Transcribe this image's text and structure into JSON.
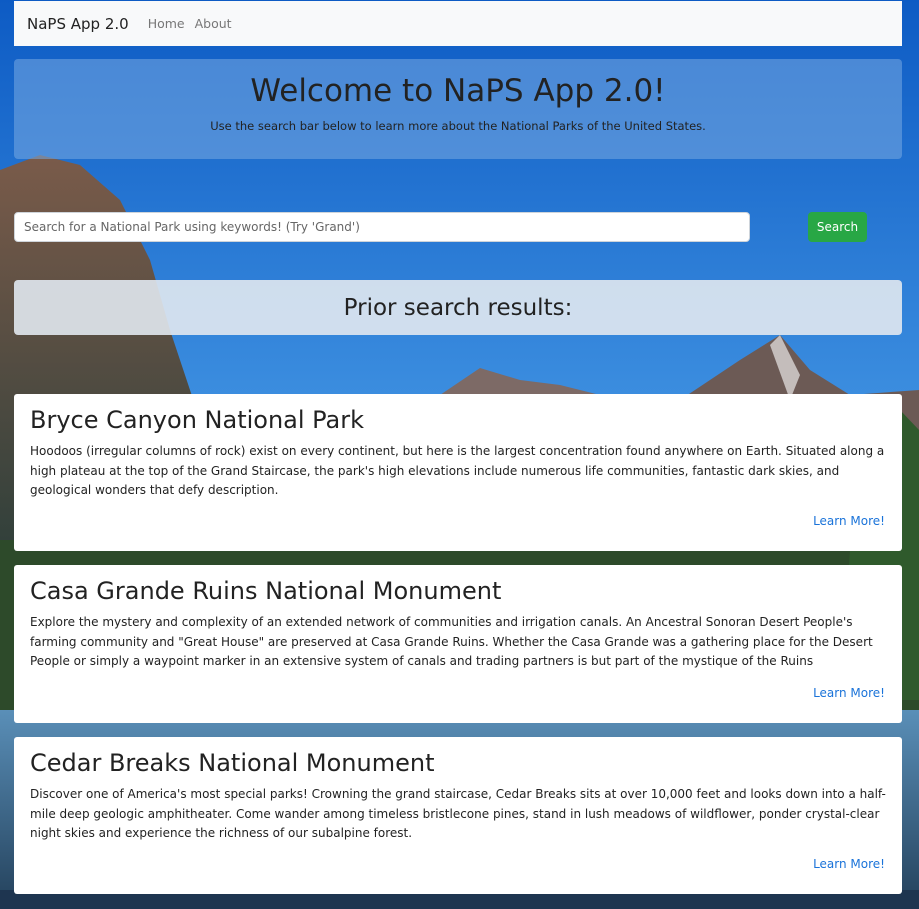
{
  "navbar": {
    "brand": "NaPS App 2.0",
    "links": [
      "Home",
      "About"
    ]
  },
  "jumbotron": {
    "title": "Welcome to NaPS App 2.0!",
    "subtitle": "Use the search bar below to learn more about the National Parks of the United States."
  },
  "search": {
    "placeholder": "Search for a National Park using keywords! (Try 'Grand')",
    "value": "",
    "button_label": "Search"
  },
  "prior": {
    "heading": "Prior search results:"
  },
  "results": [
    {
      "title": "Bryce Canyon National Park",
      "description": "Hoodoos (irregular columns of rock) exist on every continent, but here is the largest concentration found anywhere on Earth. Situated along a high plateau at the top of the Grand Staircase, the park's high elevations include numerous life communities, fantastic dark skies, and geological wonders that defy description.",
      "link_label": "Learn More!"
    },
    {
      "title": "Casa Grande Ruins National Monument",
      "description": "Explore the mystery and complexity of an extended network of communities and irrigation canals. An Ancestral Sonoran Desert People's farming community and \"Great House\" are preserved at Casa Grande Ruins. Whether the Casa Grande was a gathering place for the Desert People or simply a waypoint marker in an extensive system of canals and trading partners is but part of the mystique of the Ruins",
      "link_label": "Learn More!"
    },
    {
      "title": "Cedar Breaks National Monument",
      "description": "Discover one of America's most special parks! Crowning the grand staircase, Cedar Breaks sits at over 10,000 feet and looks down into a half-mile deep geologic amphitheater. Come wander among timeless bristlecone pines, stand in lush meadows of wildflower, ponder crystal-clear night skies and experience the richness of our subalpine forest.",
      "link_label": "Learn More!"
    }
  ],
  "colors": {
    "sky": "#1b6fd0",
    "search_button": "#28a745",
    "link": "#1a73d9"
  }
}
